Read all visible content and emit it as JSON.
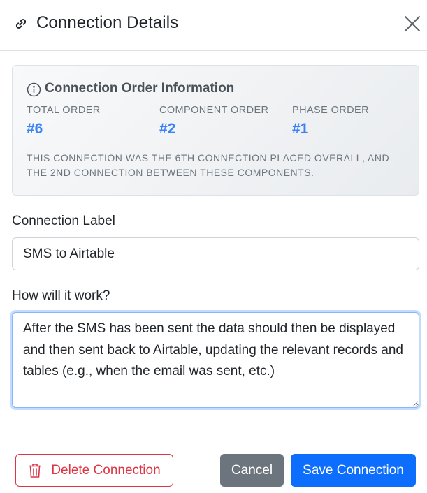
{
  "header": {
    "title": "Connection Details",
    "link_icon": "link-icon",
    "close_icon": "close-icon"
  },
  "order_info": {
    "title": "Connection Order Information",
    "icon": "info-icon",
    "stats": [
      {
        "label": "TOTAL ORDER",
        "value": "#6"
      },
      {
        "label": "COMPONENT ORDER",
        "value": "#2"
      },
      {
        "label": "PHASE ORDER",
        "value": "#1"
      }
    ],
    "note": "THIS CONNECTION WAS THE 6TH CONNECTION PLACED OVERALL, AND THE 2ND CONNECTION BETWEEN THESE COMPONENTS."
  },
  "form": {
    "label_field_label": "Connection Label",
    "label_value": "SMS to Airtable",
    "how_field_label": "How will it work?",
    "how_value": "After the SMS has been sent the data should then be displayed and then sent back to Airtable, updating the relevant records and tables (e.g., when the email was sent, etc.)"
  },
  "footer": {
    "delete_label": "Delete Connection",
    "delete_icon": "trash-icon",
    "cancel_label": "Cancel",
    "save_label": "Save Connection"
  },
  "colors": {
    "accent": "#3b82f6",
    "primary": "#0d6efd",
    "danger": "#dc3545",
    "secondary": "#6c757d"
  }
}
